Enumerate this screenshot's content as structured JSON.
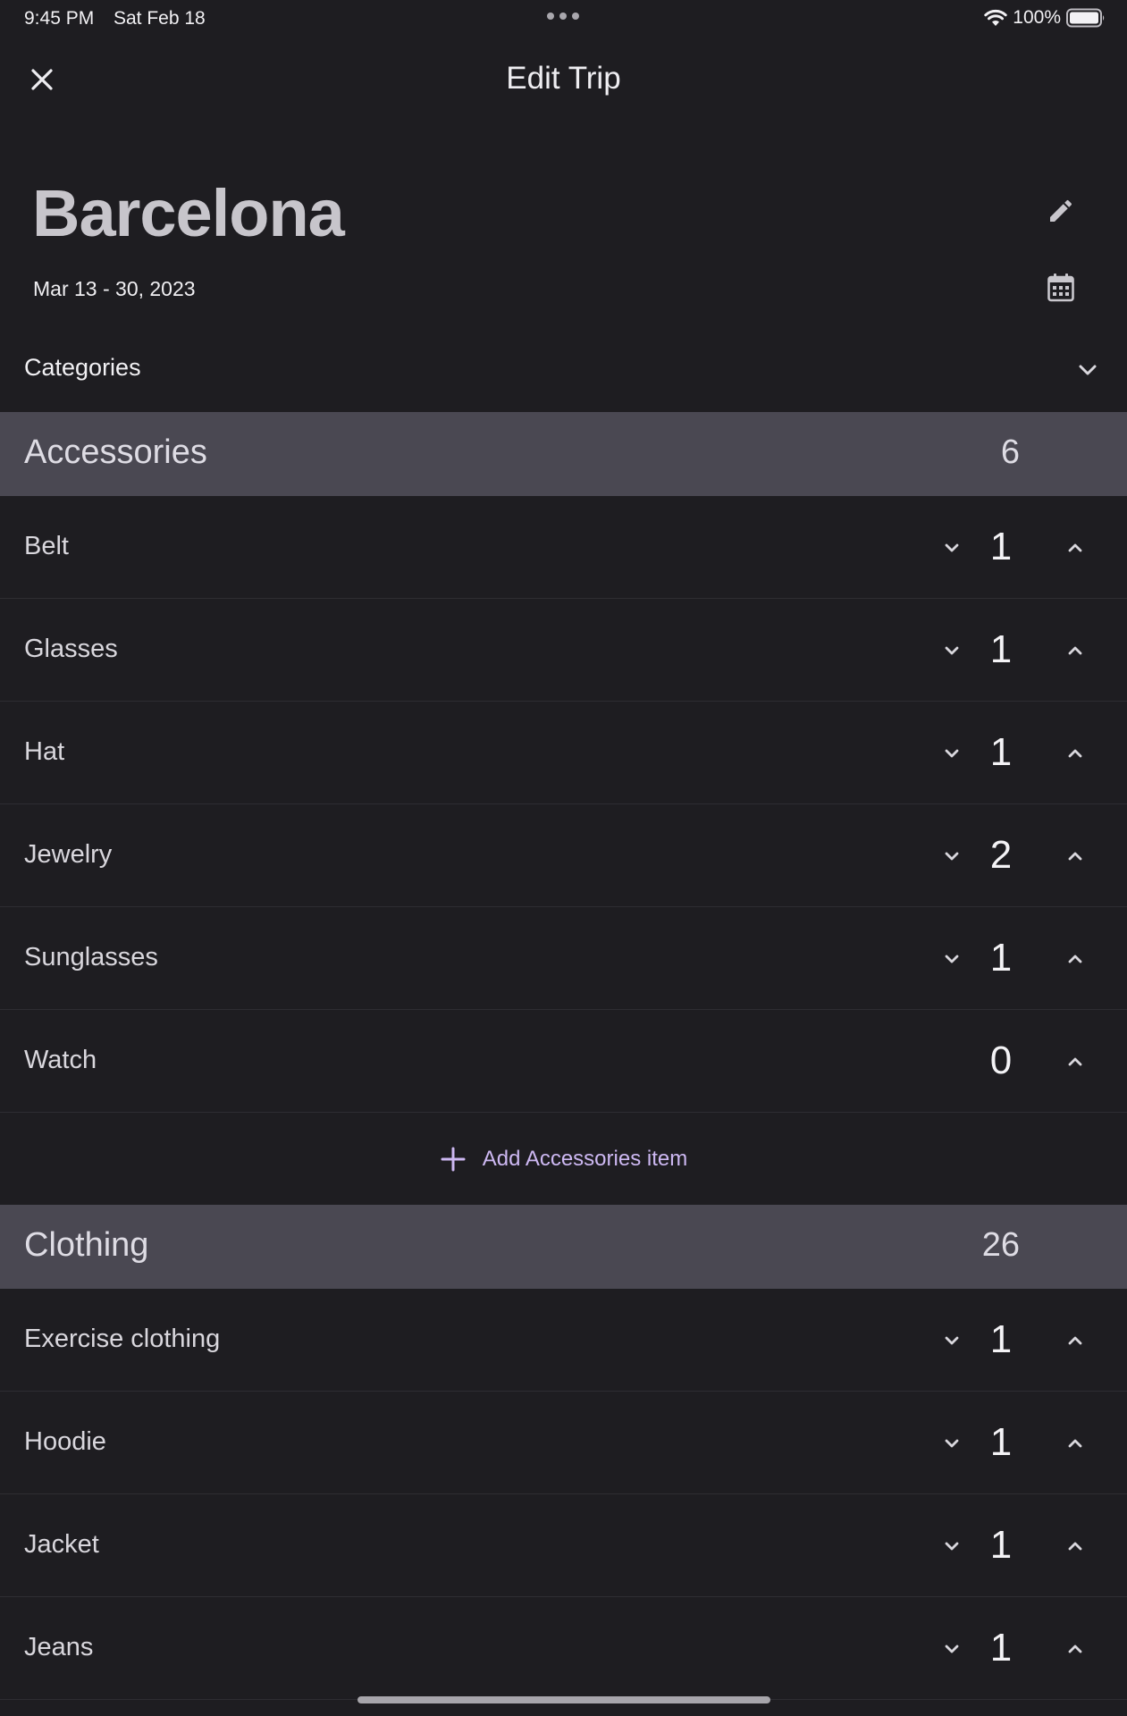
{
  "status_bar": {
    "time": "9:45 PM",
    "date": "Sat Feb 18",
    "battery": "100%"
  },
  "nav": {
    "title": "Edit Trip"
  },
  "trip": {
    "name": "Barcelona",
    "dates": "Mar 13 - 30, 2023"
  },
  "categories_label": "Categories",
  "sections": [
    {
      "title": "Accessories",
      "count": "6",
      "add_label": "Add Accessories item",
      "items": [
        {
          "label": "Belt",
          "qty": "1"
        },
        {
          "label": "Glasses",
          "qty": "1"
        },
        {
          "label": "Hat",
          "qty": "1"
        },
        {
          "label": "Jewelry",
          "qty": "2"
        },
        {
          "label": "Sunglasses",
          "qty": "1"
        },
        {
          "label": "Watch",
          "qty": "0"
        }
      ]
    },
    {
      "title": "Clothing",
      "count": "26",
      "items": [
        {
          "label": "Exercise clothing",
          "qty": "1"
        },
        {
          "label": "Hoodie",
          "qty": "1"
        },
        {
          "label": "Jacket",
          "qty": "1"
        },
        {
          "label": "Jeans",
          "qty": "1"
        }
      ]
    }
  ],
  "colors": {
    "background": "#1e1d21",
    "section_header": "#4a4852",
    "accent": "#cdb8f2"
  }
}
